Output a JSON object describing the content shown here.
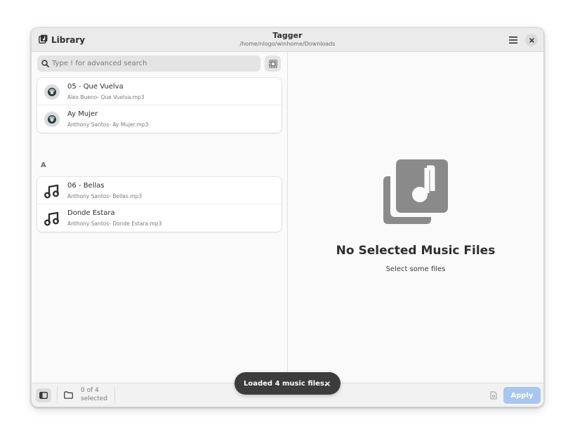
{
  "header": {
    "library_label": "Library",
    "title": "Tagger",
    "subtitle": "/home/nlogo/winhome/Downloads"
  },
  "search": {
    "placeholder": "Type ! for advanced search",
    "value": ""
  },
  "groups": [
    {
      "letter": "",
      "items": [
        {
          "title": "05 - Que Vuelva",
          "subtitle": "Alex Bueno- Que Vuelva.mp3",
          "art": "album-art"
        },
        {
          "title": "Ay Mujer",
          "subtitle": "Anthony Santos- Ay Mujer.mp3",
          "art": "album-art"
        }
      ]
    },
    {
      "letter": "A",
      "items": [
        {
          "title": "06 - Bellas",
          "subtitle": "Anthony Santos- Bellas.mp3",
          "art": "music-note-icon"
        },
        {
          "title": "Donde Estara",
          "subtitle": "Anthony Santos- Donde Estara.mp3",
          "art": "music-note-icon"
        }
      ]
    }
  ],
  "empty_state": {
    "title": "No Selected Music Files",
    "subtitle": "Select some files",
    "icon": "music-library-icon"
  },
  "bottombar": {
    "selection_count": "0 of 4",
    "selection_label": "selected",
    "apply_label": "Apply"
  },
  "toast": {
    "message": "Loaded 4 music files."
  },
  "colors": {
    "accent_disabled": "#a8c6ee",
    "toast_bg": "#3c3c3c"
  }
}
